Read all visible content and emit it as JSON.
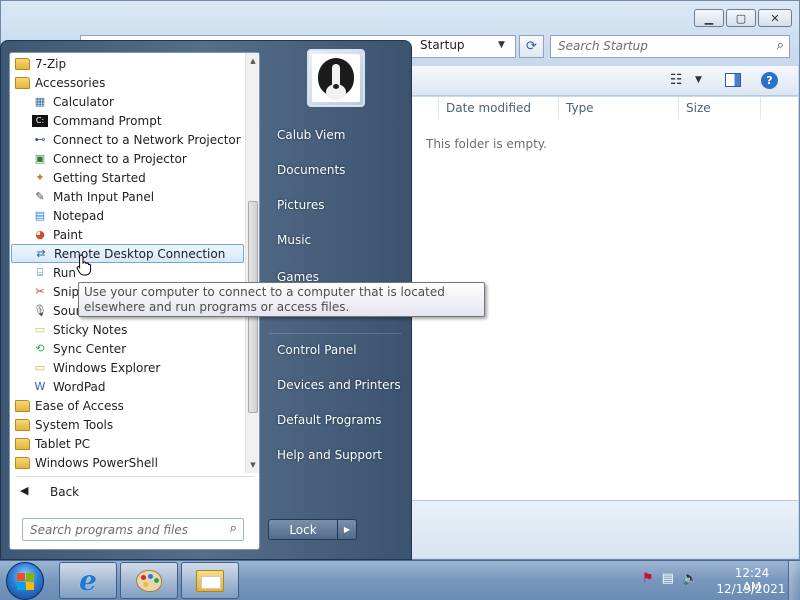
{
  "explorer": {
    "address_current": "Startup",
    "search_placeholder": "Search Startup",
    "columns": [
      "Date modified",
      "Type",
      "Size"
    ],
    "empty_message": "This folder is empty."
  },
  "start_menu": {
    "programs": [
      {
        "label": "7-Zip",
        "icon": "folder-icon"
      },
      {
        "label": "Accessories",
        "icon": "folder-icon"
      },
      {
        "label": "Calculator",
        "icon": "calculator-icon"
      },
      {
        "label": "Command Prompt",
        "icon": "command-prompt-icon"
      },
      {
        "label": "Connect to a Network Projector",
        "icon": "network-projector-icon"
      },
      {
        "label": "Connect to a Projector",
        "icon": "projector-icon"
      },
      {
        "label": "Getting Started",
        "icon": "getting-started-icon"
      },
      {
        "label": "Math Input Panel",
        "icon": "math-input-icon"
      },
      {
        "label": "Notepad",
        "icon": "notepad-icon"
      },
      {
        "label": "Paint",
        "icon": "paint-icon"
      },
      {
        "label": "Remote Desktop Connection",
        "icon": "remote-desktop-icon"
      },
      {
        "label": "Run",
        "icon": "run-icon"
      },
      {
        "label": "Snipp",
        "icon": "snipping-tool-icon"
      },
      {
        "label": "Soun",
        "icon": "sound-recorder-icon"
      },
      {
        "label": "Sticky Notes",
        "icon": "sticky-notes-icon"
      },
      {
        "label": "Sync Center",
        "icon": "sync-center-icon"
      },
      {
        "label": "Windows Explorer",
        "icon": "windows-explorer-icon"
      },
      {
        "label": "WordPad",
        "icon": "wordpad-icon"
      },
      {
        "label": "Ease of Access",
        "icon": "folder-icon"
      },
      {
        "label": "System Tools",
        "icon": "folder-icon"
      },
      {
        "label": "Tablet PC",
        "icon": "folder-icon"
      },
      {
        "label": "Windows PowerShell",
        "icon": "folder-icon"
      }
    ],
    "highlighted_index": 10,
    "back_label": "Back",
    "search_placeholder": "Search programs and files",
    "right_items": [
      "Calub Viem",
      "Documents",
      "Pictures",
      "Music",
      "Games",
      "Control Panel",
      "Devices and Printers",
      "Default Programs",
      "Help and Support"
    ],
    "lock_label": "Lock",
    "tooltip": "Use your computer to connect to a computer that is located elsewhere and run programs or access files."
  },
  "taskbar": {
    "pinned": [
      "internet-explorer-icon",
      "paint-icon",
      "windows-explorer-icon"
    ],
    "clock_time": "12:24 AM",
    "clock_date": "12/19/2021"
  }
}
